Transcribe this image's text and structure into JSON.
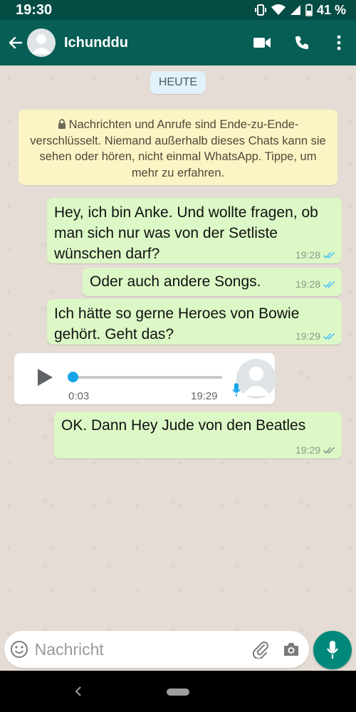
{
  "status_bar": {
    "time": "19:30",
    "battery": "41 %"
  },
  "header": {
    "contact_name": "Ichunddu"
  },
  "chat": {
    "date_chip": "HEUTE",
    "encryption_notice": "Nachrichten und Anrufe sind Ende-zu-Ende-verschlüsselt. Niemand außerhalb dieses Chats kann sie sehen oder hören, nicht einmal WhatsApp. Tippe, um mehr zu erfahren.",
    "messages": [
      {
        "text": "Hey, ich bin Anke. Und wollte fragen, ob man sich nur was von der Setliste wünschen darf?",
        "time": "19:28",
        "status": "read"
      },
      {
        "text": "Oder auch andere Songs.",
        "time": "19:28",
        "status": "read"
      },
      {
        "text": "Ich hätte so gerne Heroes von Bowie gehört. Geht das?",
        "time": "19:29",
        "status": "read"
      },
      {
        "type": "voice",
        "duration": "0:03",
        "time": "19:29",
        "progress": 0
      },
      {
        "text": "OK. Dann Hey Jude von den Beatles",
        "time": "19:29",
        "status": "delivered"
      }
    ]
  },
  "composer": {
    "placeholder": "Nachricht"
  },
  "colors": {
    "header": "#075e54",
    "status_bar": "#054d44",
    "outgoing_bubble": "#dcf8c6",
    "read_ticks": "#4fc3f7",
    "accent": "#00897b"
  },
  "icons": [
    "back-arrow-icon",
    "video-call-icon",
    "phone-icon",
    "more-vert-icon",
    "lock-icon",
    "play-icon",
    "mic-icon",
    "emoji-icon",
    "attach-icon",
    "camera-icon"
  ]
}
